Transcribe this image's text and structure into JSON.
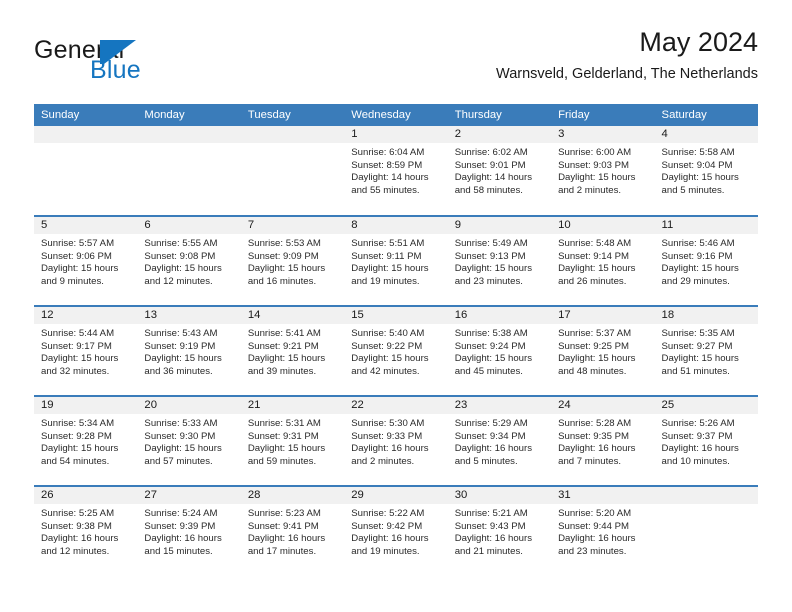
{
  "brand": {
    "name_part1": "General",
    "name_part2": "Blue",
    "mark": "triangle-logo",
    "accent_color": "#1575c0"
  },
  "header": {
    "title": "May 2024",
    "subtitle": "Warnsveld, Gelderland, The Netherlands"
  },
  "theme": {
    "header_blue": "#3a7cba",
    "day_band_grey": "#f1f1f1",
    "text_color": "#1a1a1a"
  },
  "weekday_headers": [
    "Sunday",
    "Monday",
    "Tuesday",
    "Wednesday",
    "Thursday",
    "Friday",
    "Saturday"
  ],
  "weeks": [
    [
      {
        "day": "",
        "empty": true
      },
      {
        "day": "",
        "empty": true
      },
      {
        "day": "",
        "empty": true
      },
      {
        "day": "1",
        "sunrise": "Sunrise: 6:04 AM",
        "sunset": "Sunset: 8:59 PM",
        "daylight_line1": "Daylight: 14 hours",
        "daylight_line2": "and 55 minutes."
      },
      {
        "day": "2",
        "sunrise": "Sunrise: 6:02 AM",
        "sunset": "Sunset: 9:01 PM",
        "daylight_line1": "Daylight: 14 hours",
        "daylight_line2": "and 58 minutes."
      },
      {
        "day": "3",
        "sunrise": "Sunrise: 6:00 AM",
        "sunset": "Sunset: 9:03 PM",
        "daylight_line1": "Daylight: 15 hours",
        "daylight_line2": "and 2 minutes."
      },
      {
        "day": "4",
        "sunrise": "Sunrise: 5:58 AM",
        "sunset": "Sunset: 9:04 PM",
        "daylight_line1": "Daylight: 15 hours",
        "daylight_line2": "and 5 minutes."
      }
    ],
    [
      {
        "day": "5",
        "sunrise": "Sunrise: 5:57 AM",
        "sunset": "Sunset: 9:06 PM",
        "daylight_line1": "Daylight: 15 hours",
        "daylight_line2": "and 9 minutes."
      },
      {
        "day": "6",
        "sunrise": "Sunrise: 5:55 AM",
        "sunset": "Sunset: 9:08 PM",
        "daylight_line1": "Daylight: 15 hours",
        "daylight_line2": "and 12 minutes."
      },
      {
        "day": "7",
        "sunrise": "Sunrise: 5:53 AM",
        "sunset": "Sunset: 9:09 PM",
        "daylight_line1": "Daylight: 15 hours",
        "daylight_line2": "and 16 minutes."
      },
      {
        "day": "8",
        "sunrise": "Sunrise: 5:51 AM",
        "sunset": "Sunset: 9:11 PM",
        "daylight_line1": "Daylight: 15 hours",
        "daylight_line2": "and 19 minutes."
      },
      {
        "day": "9",
        "sunrise": "Sunrise: 5:49 AM",
        "sunset": "Sunset: 9:13 PM",
        "daylight_line1": "Daylight: 15 hours",
        "daylight_line2": "and 23 minutes."
      },
      {
        "day": "10",
        "sunrise": "Sunrise: 5:48 AM",
        "sunset": "Sunset: 9:14 PM",
        "daylight_line1": "Daylight: 15 hours",
        "daylight_line2": "and 26 minutes."
      },
      {
        "day": "11",
        "sunrise": "Sunrise: 5:46 AM",
        "sunset": "Sunset: 9:16 PM",
        "daylight_line1": "Daylight: 15 hours",
        "daylight_line2": "and 29 minutes."
      }
    ],
    [
      {
        "day": "12",
        "sunrise": "Sunrise: 5:44 AM",
        "sunset": "Sunset: 9:17 PM",
        "daylight_line1": "Daylight: 15 hours",
        "daylight_line2": "and 32 minutes."
      },
      {
        "day": "13",
        "sunrise": "Sunrise: 5:43 AM",
        "sunset": "Sunset: 9:19 PM",
        "daylight_line1": "Daylight: 15 hours",
        "daylight_line2": "and 36 minutes."
      },
      {
        "day": "14",
        "sunrise": "Sunrise: 5:41 AM",
        "sunset": "Sunset: 9:21 PM",
        "daylight_line1": "Daylight: 15 hours",
        "daylight_line2": "and 39 minutes."
      },
      {
        "day": "15",
        "sunrise": "Sunrise: 5:40 AM",
        "sunset": "Sunset: 9:22 PM",
        "daylight_line1": "Daylight: 15 hours",
        "daylight_line2": "and 42 minutes."
      },
      {
        "day": "16",
        "sunrise": "Sunrise: 5:38 AM",
        "sunset": "Sunset: 9:24 PM",
        "daylight_line1": "Daylight: 15 hours",
        "daylight_line2": "and 45 minutes."
      },
      {
        "day": "17",
        "sunrise": "Sunrise: 5:37 AM",
        "sunset": "Sunset: 9:25 PM",
        "daylight_line1": "Daylight: 15 hours",
        "daylight_line2": "and 48 minutes."
      },
      {
        "day": "18",
        "sunrise": "Sunrise: 5:35 AM",
        "sunset": "Sunset: 9:27 PM",
        "daylight_line1": "Daylight: 15 hours",
        "daylight_line2": "and 51 minutes."
      }
    ],
    [
      {
        "day": "19",
        "sunrise": "Sunrise: 5:34 AM",
        "sunset": "Sunset: 9:28 PM",
        "daylight_line1": "Daylight: 15 hours",
        "daylight_line2": "and 54 minutes."
      },
      {
        "day": "20",
        "sunrise": "Sunrise: 5:33 AM",
        "sunset": "Sunset: 9:30 PM",
        "daylight_line1": "Daylight: 15 hours",
        "daylight_line2": "and 57 minutes."
      },
      {
        "day": "21",
        "sunrise": "Sunrise: 5:31 AM",
        "sunset": "Sunset: 9:31 PM",
        "daylight_line1": "Daylight: 15 hours",
        "daylight_line2": "and 59 minutes."
      },
      {
        "day": "22",
        "sunrise": "Sunrise: 5:30 AM",
        "sunset": "Sunset: 9:33 PM",
        "daylight_line1": "Daylight: 16 hours",
        "daylight_line2": "and 2 minutes."
      },
      {
        "day": "23",
        "sunrise": "Sunrise: 5:29 AM",
        "sunset": "Sunset: 9:34 PM",
        "daylight_line1": "Daylight: 16 hours",
        "daylight_line2": "and 5 minutes."
      },
      {
        "day": "24",
        "sunrise": "Sunrise: 5:28 AM",
        "sunset": "Sunset: 9:35 PM",
        "daylight_line1": "Daylight: 16 hours",
        "daylight_line2": "and 7 minutes."
      },
      {
        "day": "25",
        "sunrise": "Sunrise: 5:26 AM",
        "sunset": "Sunset: 9:37 PM",
        "daylight_line1": "Daylight: 16 hours",
        "daylight_line2": "and 10 minutes."
      }
    ],
    [
      {
        "day": "26",
        "sunrise": "Sunrise: 5:25 AM",
        "sunset": "Sunset: 9:38 PM",
        "daylight_line1": "Daylight: 16 hours",
        "daylight_line2": "and 12 minutes."
      },
      {
        "day": "27",
        "sunrise": "Sunrise: 5:24 AM",
        "sunset": "Sunset: 9:39 PM",
        "daylight_line1": "Daylight: 16 hours",
        "daylight_line2": "and 15 minutes."
      },
      {
        "day": "28",
        "sunrise": "Sunrise: 5:23 AM",
        "sunset": "Sunset: 9:41 PM",
        "daylight_line1": "Daylight: 16 hours",
        "daylight_line2": "and 17 minutes."
      },
      {
        "day": "29",
        "sunrise": "Sunrise: 5:22 AM",
        "sunset": "Sunset: 9:42 PM",
        "daylight_line1": "Daylight: 16 hours",
        "daylight_line2": "and 19 minutes."
      },
      {
        "day": "30",
        "sunrise": "Sunrise: 5:21 AM",
        "sunset": "Sunset: 9:43 PM",
        "daylight_line1": "Daylight: 16 hours",
        "daylight_line2": "and 21 minutes."
      },
      {
        "day": "31",
        "sunrise": "Sunrise: 5:20 AM",
        "sunset": "Sunset: 9:44 PM",
        "daylight_line1": "Daylight: 16 hours",
        "daylight_line2": "and 23 minutes."
      },
      {
        "day": "",
        "empty": true
      }
    ]
  ]
}
